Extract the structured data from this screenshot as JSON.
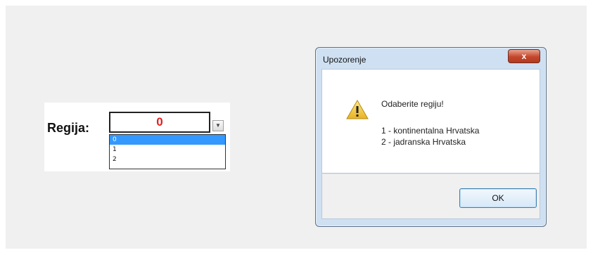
{
  "region_selector": {
    "label": "Regija:",
    "current_value": "0",
    "options": [
      "0",
      "1",
      "2"
    ],
    "selected_option": "0"
  },
  "dialog": {
    "title": "Upozorenje",
    "close_label": "x",
    "icon": "warning-icon",
    "message_title": "Odaberite regiju!",
    "lines": [
      "1 - kontinentalna Hrvatska",
      "2 - jadranska Hrvatska"
    ],
    "ok_label": "OK"
  },
  "colors": {
    "value_red": "#e02020",
    "selection_blue": "#3399ff",
    "close_red": "#c4472c"
  }
}
